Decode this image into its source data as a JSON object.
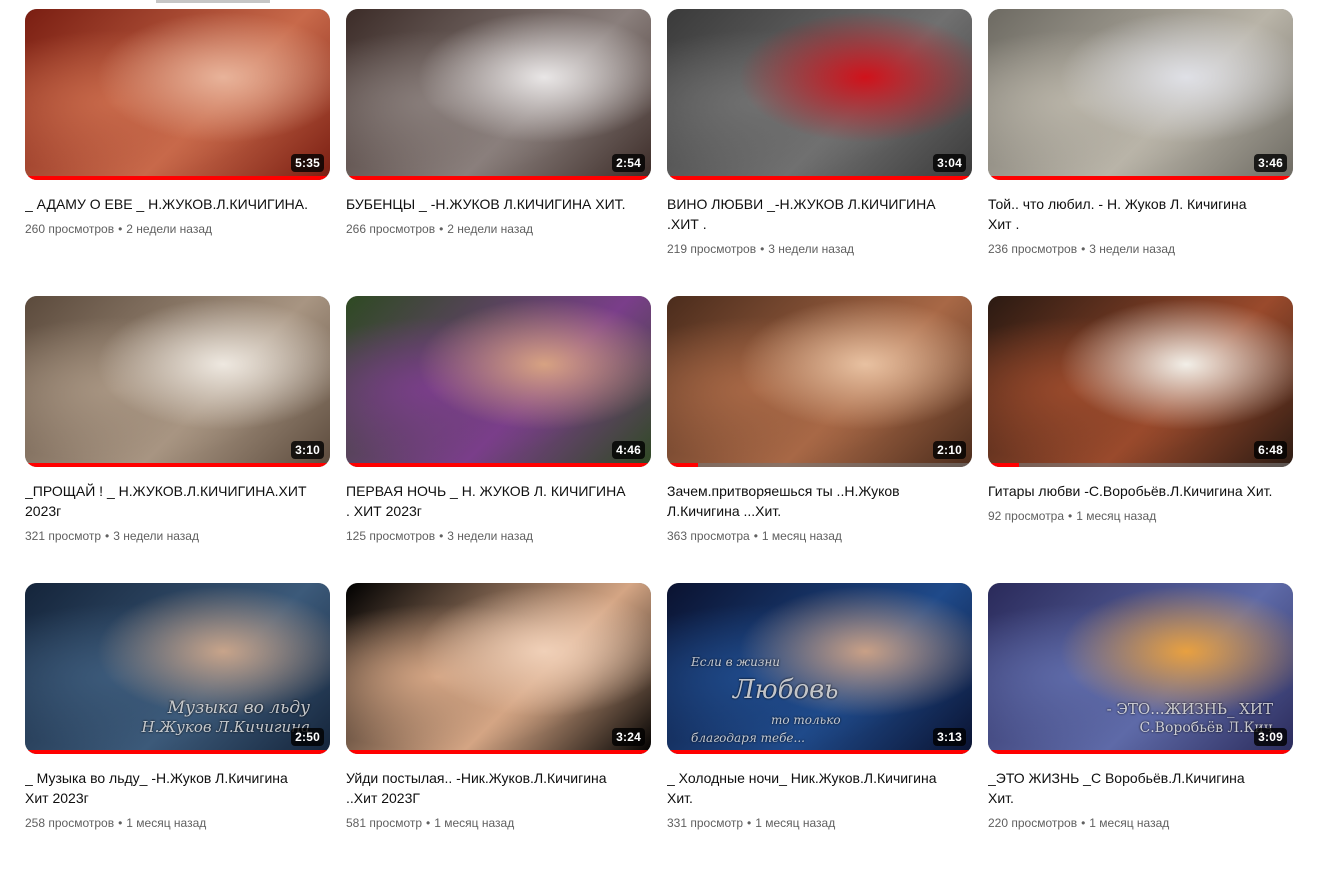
{
  "videos": [
    {
      "title": "_ АДАМУ О ЕВЕ _ Н.ЖУКОВ.Л.КИЧИГИНА.",
      "views": "260 просмотров",
      "age": "2 недели назад",
      "duration": "5:35",
      "progress": 1.0,
      "colors": [
        "#7a1e12",
        "#c8694a",
        "#e8b39a"
      ]
    },
    {
      "title": "БУБЕНЦЫ _ -Н.ЖУКОВ Л.КИЧИГИНА ХИТ.",
      "views": "266 просмотров",
      "age": "2 недели назад",
      "duration": "2:54",
      "progress": 1.0,
      "colors": [
        "#3c2c28",
        "#8a7f7c",
        "#e9e6e6"
      ]
    },
    {
      "title": "ВИНО ЛЮБВИ _-Н.ЖУКОВ Л.КИЧИГИНА .ХИТ .",
      "views": "219 просмотров",
      "age": "3 недели назад",
      "duration": "3:04",
      "progress": 1.0,
      "colors": [
        "#3a3a3a",
        "#707070",
        "#d0121b"
      ]
    },
    {
      "title": "Той.. что любил. - Н. Жуков Л. Кичигина Хит .",
      "views": "236 просмотров",
      "age": "3 недели назад",
      "duration": "3:46",
      "progress": 1.0,
      "colors": [
        "#6d6a62",
        "#b9b4a8",
        "#dfe0e6"
      ]
    },
    {
      "title": "_ПРОЩАЙ ! _ Н.ЖУКОВ.Л.КИЧИГИНА.ХИТ 2023г",
      "views": "321 просмотр",
      "age": "3 недели назад",
      "duration": "3:10",
      "progress": 1.0,
      "colors": [
        "#5b4a3c",
        "#a89582",
        "#eee8e0"
      ]
    },
    {
      "title": "ПЕРВАЯ НОЧЬ _ Н. ЖУКОВ Л. КИЧИГИНА . ХИТ 2023г",
      "views": "125 просмотров",
      "age": "3 недели назад",
      "duration": "4:46",
      "progress": 1.0,
      "colors": [
        "#2e4a22",
        "#7a3e8a",
        "#d7a282"
      ]
    },
    {
      "title": "Зачем.притворяешься ты ..Н.Жуков Л.Кичигина ...Хит.",
      "views": "363 просмотра",
      "age": "1 месяц назад",
      "duration": "2:10",
      "progress": 0.1,
      "colors": [
        "#4b2c1c",
        "#a86846",
        "#e8c1a1"
      ]
    },
    {
      "title": "Гитары любви -С.Воробьёв.Л.Кичигина Хит.",
      "views": "92 просмотра",
      "age": "1 месяц назад",
      "duration": "6:48",
      "progress": 0.1,
      "colors": [
        "#2b1a12",
        "#9a4a2c",
        "#f2efe8"
      ]
    },
    {
      "title": "_ Музыка во льду_ -Н.Жуков Л.Кичигина Хит 2023г",
      "views": "258 просмотров",
      "age": "1 месяц назад",
      "duration": "2:50",
      "progress": 1.0,
      "colors": [
        "#14243a",
        "#3c5a7a",
        "#c8a48a"
      ],
      "overlay": [
        "Музыка во льду",
        "Н.Жуков Л.Кичигина"
      ]
    },
    {
      "title": "Уйди постылая.. -Ник.Жуков.Л.Кичигина ..Хит 2023Г",
      "views": "581 просмотр",
      "age": "1 месяц назад",
      "duration": "3:24",
      "progress": 1.0,
      "colors": [
        "#000000",
        "#d4a584",
        "#f0d0b8"
      ]
    },
    {
      "title": "_ Холодные ночи_ Ник.Жуков.Л.Кичигина Хит.",
      "views": "331 просмотр",
      "age": "1 месяц назад",
      "duration": "3:13",
      "progress": 1.0,
      "colors": [
        "#0a1230",
        "#1f4a8a",
        "#c9a086"
      ],
      "overlay": [
        "Если в жизни",
        "Любовь",
        "то только",
        "благодаря тебе..."
      ]
    },
    {
      "title": "_ЭТО ЖИЗНЬ _С Воробьёв.Л.Кичигина Хит.",
      "views": "220 просмотров",
      "age": "1 месяц назад",
      "duration": "3:09",
      "progress": 1.0,
      "colors": [
        "#2a2a5a",
        "#5e6aa8",
        "#e8a040"
      ],
      "overlay": [
        "- ЭТО...ЖИЗНЬ_ ХИТ",
        "С.Воробьёв Л.Кич"
      ]
    }
  ]
}
